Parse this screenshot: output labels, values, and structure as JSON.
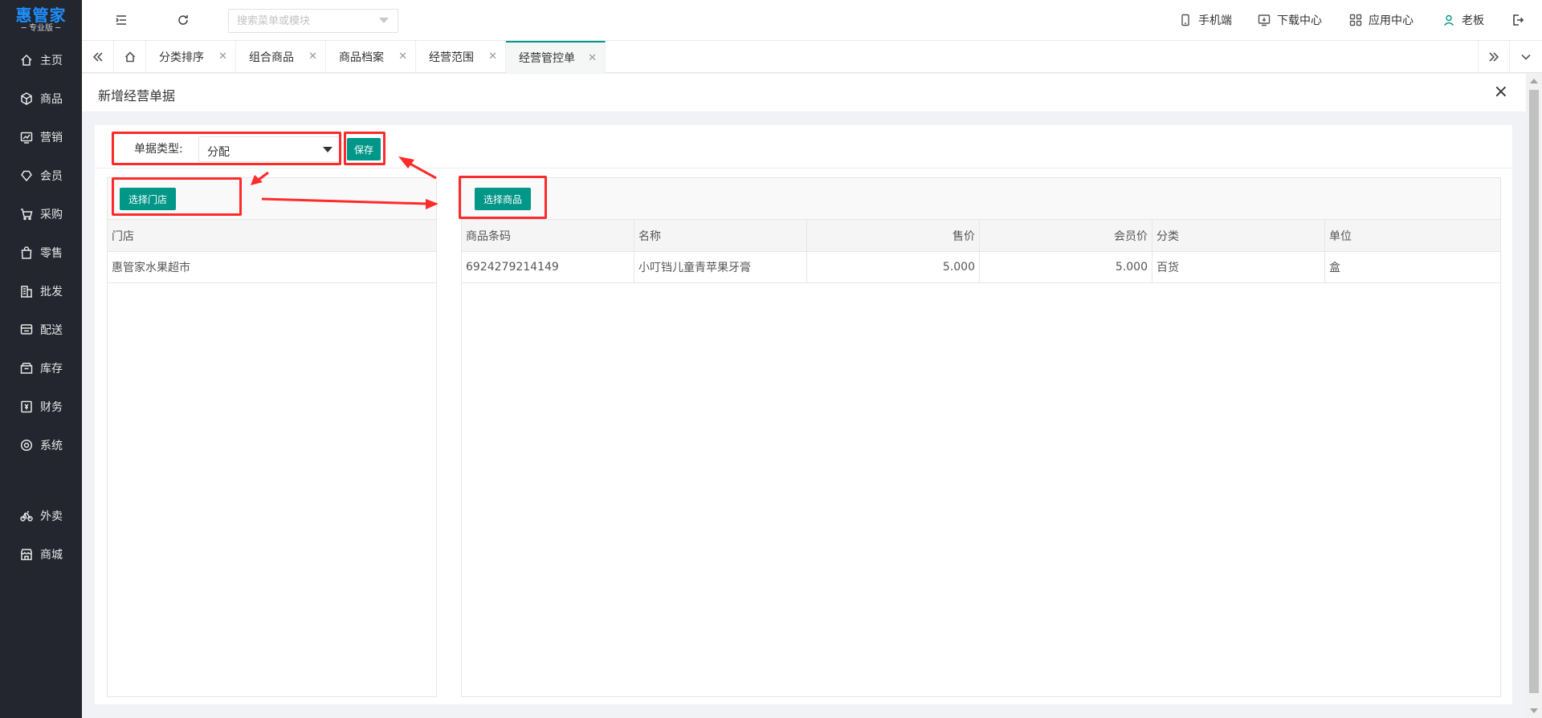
{
  "brand": {
    "name": "惠管家",
    "edition": "─ 专业版 ─"
  },
  "sidebar": {
    "items": [
      {
        "label": "主页",
        "icon": "home-icon"
      },
      {
        "label": "商品",
        "icon": "box-icon"
      },
      {
        "label": "营销",
        "icon": "chart-icon"
      },
      {
        "label": "会员",
        "icon": "diamond-icon"
      },
      {
        "label": "采购",
        "icon": "cart-icon"
      },
      {
        "label": "零售",
        "icon": "bag-icon"
      },
      {
        "label": "批发",
        "icon": "building-icon"
      },
      {
        "label": "配送",
        "icon": "truck-icon"
      },
      {
        "label": "库存",
        "icon": "inbox-icon"
      },
      {
        "label": "财务",
        "icon": "finance-icon"
      },
      {
        "label": "系统",
        "icon": "settings-icon"
      },
      {
        "label": "外卖",
        "icon": "bike-icon"
      },
      {
        "label": "商城",
        "icon": "store-icon"
      }
    ]
  },
  "topbar": {
    "search_placeholder": "搜索菜单或模块",
    "mobile": "手机端",
    "download": "下载中心",
    "apps": "应用中心",
    "user": "老板"
  },
  "tabs": [
    {
      "label": "分类排序"
    },
    {
      "label": "组合商品"
    },
    {
      "label": "商品档案"
    },
    {
      "label": "经营范围"
    },
    {
      "label": "经营管控单"
    }
  ],
  "panel": {
    "title": "新增经营单据",
    "close": "×",
    "type_label": "单据类型:",
    "type_value": "分配",
    "save": "保存"
  },
  "stores": {
    "button": "选择门店",
    "header": "门店",
    "rows": [
      "惠管家水果超市"
    ]
  },
  "products": {
    "button": "选择商品",
    "headers": {
      "barcode": "商品条码",
      "name": "名称",
      "price": "售价",
      "member_price": "会员价",
      "category": "分类",
      "unit": "单位"
    },
    "rows": [
      {
        "barcode": "6924279214149",
        "name": "小叮铛儿童青苹果牙膏",
        "price": "5.000",
        "member_price": "5.000",
        "category": "百货",
        "unit": "盒"
      }
    ]
  },
  "colors": {
    "accent": "#009688",
    "sidebar": "#23262e",
    "highlight": "#ff2a2a",
    "brand": "#1e90ff"
  }
}
